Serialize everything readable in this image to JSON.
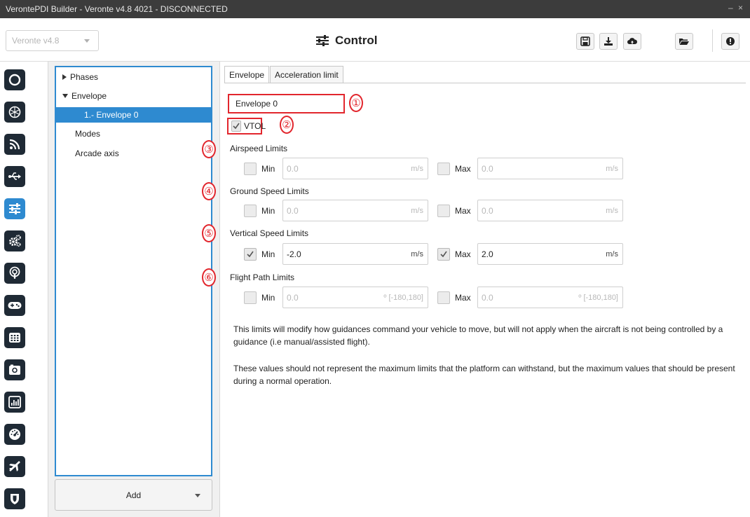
{
  "window": {
    "title": "VerontePDI Builder - Veronte v4.8 4021 - DISCONNECTED",
    "controls": "– ×"
  },
  "toolbar": {
    "version_select": "Veronte v4.8",
    "page_title": "Control",
    "buttons": [
      "save-icon",
      "download-icon",
      "cloud-icon",
      "folder-open-icon",
      "info-icon"
    ]
  },
  "sidebar_icons": [
    "power-icon",
    "sphere-icon",
    "rss-icon",
    "usb-icon",
    "sliders-icon",
    "gears-icon",
    "podcast-icon",
    "gamepad-icon",
    "keypad-icon",
    "camera-icon",
    "chart-icon",
    "gauge-icon",
    "plane-icon",
    "shield-icon"
  ],
  "tree": {
    "items": [
      {
        "label": "Phases",
        "expander": "right"
      },
      {
        "label": "Envelope",
        "expander": "down"
      },
      {
        "label": "1.- Envelope 0",
        "selected": true
      },
      {
        "label": "Modes"
      },
      {
        "label": "Arcade axis"
      }
    ],
    "add_label": "Add"
  },
  "tabs": [
    {
      "label": "Envelope",
      "active": true
    },
    {
      "label": "Acceleration limit",
      "active": false
    }
  ],
  "envelope": {
    "name": "Envelope 0",
    "vtol_label": "VTOL",
    "vtol_checked": true
  },
  "callouts": [
    "①",
    "②",
    "③",
    "④",
    "⑤",
    "⑥"
  ],
  "sections": [
    {
      "title": "Airspeed Limits",
      "min": {
        "label": "Min",
        "checked": false,
        "value": "0.0",
        "unit": "m/s"
      },
      "max": {
        "label": "Max",
        "checked": false,
        "value": "0.0",
        "unit": "m/s"
      }
    },
    {
      "title": "Ground Speed Limits",
      "min": {
        "label": "Min",
        "checked": false,
        "value": "0.0",
        "unit": "m/s"
      },
      "max": {
        "label": "Max",
        "checked": false,
        "value": "0.0",
        "unit": "m/s"
      }
    },
    {
      "title": "Vertical Speed Limits",
      "min": {
        "label": "Min",
        "checked": true,
        "value": "-2.0",
        "unit": "m/s"
      },
      "max": {
        "label": "Max",
        "checked": true,
        "value": "2.0",
        "unit": "m/s"
      }
    },
    {
      "title": "Flight Path Limits",
      "min": {
        "label": "Min",
        "checked": false,
        "value": "0.0",
        "unit": "º [-180,180]"
      },
      "max": {
        "label": "Max",
        "checked": false,
        "value": "0.0",
        "unit": "º [-180,180]"
      }
    }
  ],
  "descriptions": [
    "This limits will modify how guidances command your vehicle to move, but will not apply when the aircraft is not being controlled by a guidance (i.e manual/assisted flight).",
    "These values should not represent the maximum limits that the platform can withstand, but the maximum values that should be present during a normal operation."
  ]
}
